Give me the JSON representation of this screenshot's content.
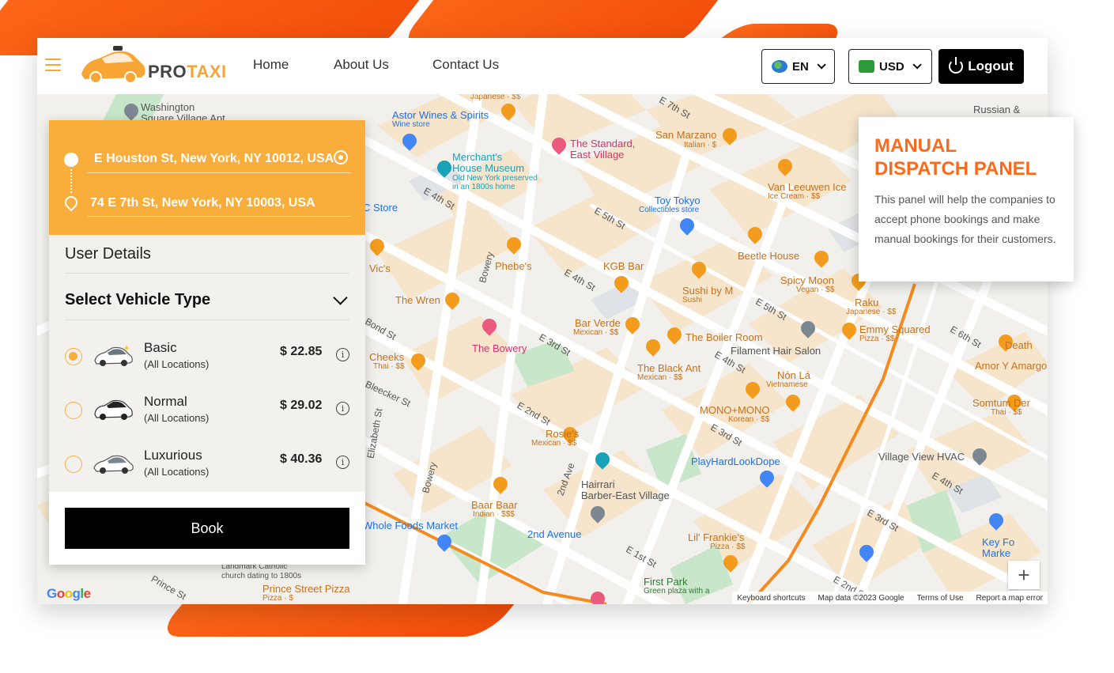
{
  "brand": {
    "name_part1": "PRO",
    "name_part2": "TAXI"
  },
  "nav": {
    "home": "Home",
    "about": "About Us",
    "contact": "Contact Us"
  },
  "language": {
    "label": "EN"
  },
  "currency": {
    "label": "USD"
  },
  "logout": {
    "label": "Logout"
  },
  "booking": {
    "pickup": "E Houston St, New York, NY 10012, USA",
    "dropoff": "74 E 7th St, New York, NY 10003, USA",
    "user_details": "User Details",
    "select_vehicle": "Select Vehicle Type",
    "vehicles": [
      {
        "name": "Basic",
        "scope": "(All Locations)",
        "price": "$ 22.85",
        "selected": true
      },
      {
        "name": "Normal",
        "scope": "(All Locations)",
        "price": "$ 29.02",
        "selected": false
      },
      {
        "name": "Luxurious",
        "scope": "(All Locations)",
        "price": "$ 40.36",
        "selected": false
      }
    ],
    "book_label": "Book"
  },
  "callout": {
    "title_line1": "MANUAL",
    "title_line2": "DISPATCH PANEL",
    "body": "This panel will help the companies to accept phone bookings and make manual bookings for their customers."
  },
  "map": {
    "places": [
      {
        "name": "Washington",
        "sub": "Square Village Apt"
      },
      {
        "name": "Astor Wines & Spirits",
        "sub": "Wine store"
      },
      {
        "name": "The Standard,",
        "sub": "East Village"
      },
      {
        "name": "San Marzano",
        "sub": "Italian · $"
      },
      {
        "name": "Merchant's",
        "sub": "House Museum"
      },
      {
        "name": "Old New York preserved",
        "sub": "in an 1800s home"
      },
      {
        "name": "Van Leeuwen Ice",
        "sub": "Ice Cream · $$"
      },
      {
        "name": "Toy Tokyo",
        "sub": "Collectibles store"
      },
      {
        "name": "Beetle House",
        "sub": ""
      },
      {
        "name": "Phebe's",
        "sub": ""
      },
      {
        "name": "KGB Bar",
        "sub": ""
      },
      {
        "name": "Sushi by M",
        "sub": "Sushi"
      },
      {
        "name": "Spicy Moon",
        "sub": "Vegan · $$"
      },
      {
        "name": "Raku",
        "sub": "Japanese · $$"
      },
      {
        "name": "Vic's",
        "sub": ""
      },
      {
        "name": "The Wren",
        "sub": ""
      },
      {
        "name": "Bar Verde",
        "sub": "Mexican · $$"
      },
      {
        "name": "The Boiler Room",
        "sub": ""
      },
      {
        "name": "Filament Hair Salon",
        "sub": ""
      },
      {
        "name": "Emmy Squared",
        "sub": "Pizza · $$"
      },
      {
        "name": "The Bowery",
        "sub": ""
      },
      {
        "name": "Cheeks",
        "sub": "Thai · $$"
      },
      {
        "name": "The Black Ant",
        "sub": "Mexican · $$"
      },
      {
        "name": "Nón Lá",
        "sub": "Vietnamese"
      },
      {
        "name": "Amor Y Amargo",
        "sub": ""
      },
      {
        "name": "MONO+MONO",
        "sub": "Korean · $$"
      },
      {
        "name": "Somtum Der",
        "sub": "Thai · $$"
      },
      {
        "name": "Rosie's",
        "sub": "Mexican · $$"
      },
      {
        "name": "PlayHardLookDope",
        "sub": ""
      },
      {
        "name": "Village View HVAC",
        "sub": ""
      },
      {
        "name": "Hairrari",
        "sub": "Barber-East Village"
      },
      {
        "name": "Baar Baar",
        "sub": "Indian · $$$"
      },
      {
        "name": "Whole Foods Market",
        "sub": ""
      },
      {
        "name": "2nd Avenue",
        "sub": ""
      },
      {
        "name": "Lil' Frankie's",
        "sub": "Pizza · $$"
      },
      {
        "name": "First Park",
        "sub": "Green plaza with a"
      },
      {
        "name": "Prince Street Pizza",
        "sub": "Pizza · $"
      },
      {
        "name": "Landmark Catholic",
        "sub": "church dating to 1800s"
      },
      {
        "name": "Russian &",
        "sub": ""
      },
      {
        "name": "Death",
        "sub": ""
      },
      {
        "name": "Key Fo",
        "sub": "Marke"
      },
      {
        "name": "C Store",
        "sub": ""
      },
      {
        "name": "Japanese · $$",
        "sub": ""
      }
    ],
    "streets": [
      "E 7th St",
      "E 4th St",
      "E 5th St",
      "E 4th St",
      "E 3rd St",
      "E 2nd St",
      "E 1st St",
      "E 5th St",
      "E 6th St",
      "E 4th St",
      "E 3rd St",
      "E 2nd St",
      "E 3rd St",
      "E 4th St",
      "E 3rd St",
      "E 2nd St",
      "Bowery",
      "Bowery",
      "2nd Ave",
      "Elizabeth St",
      "Bleecker St",
      "Bond St",
      "Prince St"
    ],
    "footer": {
      "shortcuts": "Keyboard shortcuts",
      "data": "Map data ©2023 Google",
      "terms": "Terms of Use",
      "report": "Report a map error"
    },
    "google": "Google",
    "zoom_in": "+",
    "zoom_out": "−"
  }
}
